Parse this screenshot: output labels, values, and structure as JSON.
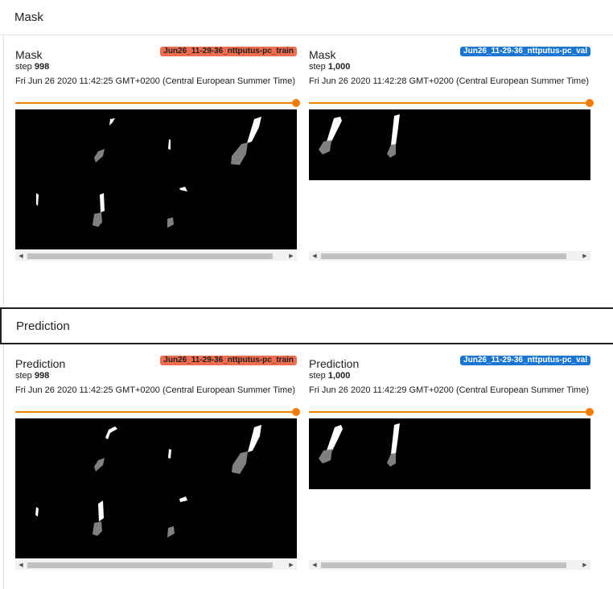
{
  "sections": {
    "mask": {
      "header": "Mask",
      "cards": [
        {
          "title": "Mask",
          "run": "Jun26_11-29-36_nttputus-pc_train",
          "step_label": "step",
          "step": "998",
          "timestamp": "Fri Jun 26 2020 11:42:25 GMT+0200 (Central European Summer Time)"
        },
        {
          "title": "Mask",
          "run": "Jun26_11-29-36_nttputus-pc_val",
          "step_label": "step",
          "step": "1,000",
          "timestamp": "Fri Jun 26 2020 11:42:28 GMT+0200 (Central European Summer Time)"
        }
      ]
    },
    "prediction": {
      "header": "Prediction",
      "cards": [
        {
          "title": "Prediction",
          "run": "Jun26_11-29-36_nttputus-pc_train",
          "step_label": "step",
          "step": "998",
          "timestamp": "Fri Jun 26 2020 11:42:25 GMT+0200 (Central European Summer Time)"
        },
        {
          "title": "Prediction",
          "run": "Jun26_11-29-36_nttputus-pc_val",
          "step_label": "step",
          "step": "1,000",
          "timestamp": "Fri Jun 26 2020 11:42:29 GMT+0200 (Central European Summer Time)"
        }
      ]
    }
  },
  "colors": {
    "train_run": "#ef6c4e",
    "val_run": "#1976d2",
    "slider": "#f57c00"
  },
  "icons": {
    "scroll_left": "scroll-left-arrow-icon",
    "scroll_right": "scroll-right-arrow-icon"
  }
}
